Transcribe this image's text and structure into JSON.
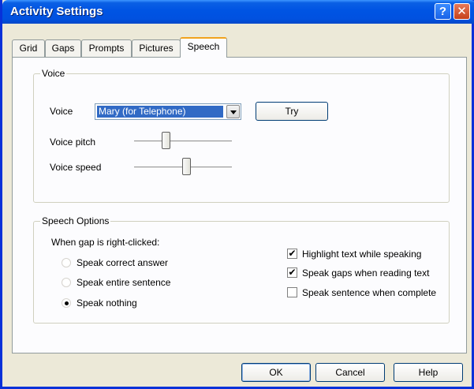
{
  "window": {
    "title": "Activity Settings"
  },
  "titlebar": {
    "help_glyph": "?",
    "close_glyph": "✕"
  },
  "tabs": [
    {
      "label": "Grid",
      "active": false
    },
    {
      "label": "Gaps",
      "active": false
    },
    {
      "label": "Prompts",
      "active": false
    },
    {
      "label": "Pictures",
      "active": false
    },
    {
      "label": "Speech",
      "active": true
    }
  ],
  "voice_group": {
    "legend": "Voice",
    "voice_label": "Voice",
    "voice_value": "Mary (for Telephone)",
    "try_label": "Try",
    "pitch_label": "Voice pitch",
    "pitch_level": 0.32,
    "speed_label": "Voice speed",
    "speed_level": 0.53
  },
  "speech_group": {
    "legend": "Speech Options",
    "right_click_label": "When  gap is right-clicked:",
    "radios": [
      {
        "label": "Speak correct answer",
        "checked": false
      },
      {
        "label": "Speak entire sentence",
        "checked": false
      },
      {
        "label": "Speak nothing",
        "checked": true
      }
    ],
    "checks": [
      {
        "label": "Highlight text while speaking",
        "checked": true
      },
      {
        "label": "Speak gaps when reading text",
        "checked": true
      },
      {
        "label": "Speak sentence when complete",
        "checked": false
      }
    ]
  },
  "footer": {
    "ok_label": "OK",
    "cancel_label": "Cancel",
    "help_label": "Help"
  },
  "check_glyph": "✔"
}
